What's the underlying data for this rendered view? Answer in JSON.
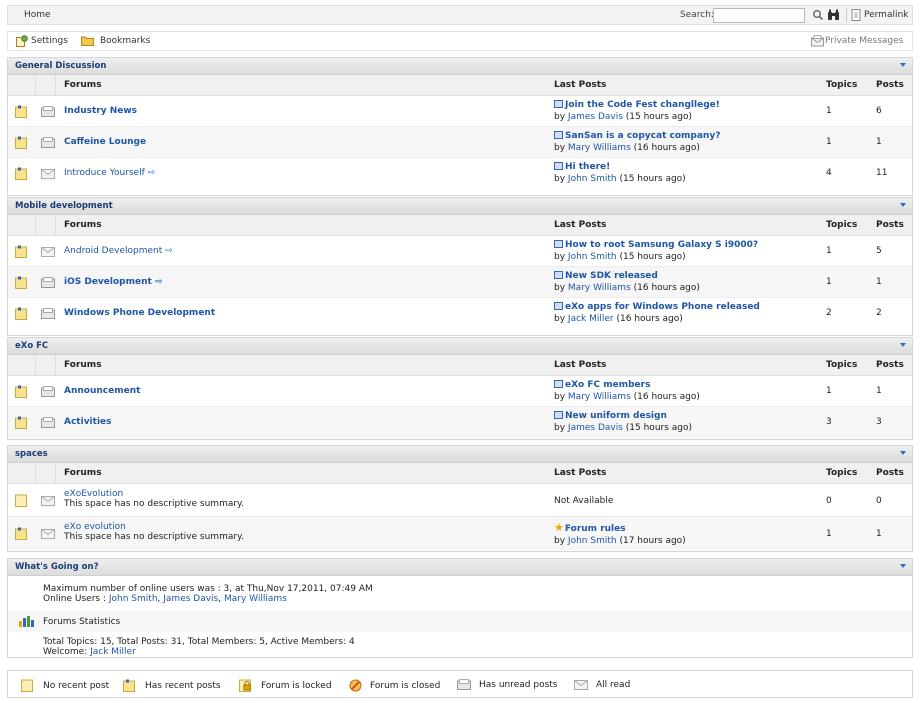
{
  "topbar": {
    "home": "Home",
    "search_label": "Search:",
    "search_value": "",
    "permalink": "Permalink"
  },
  "actions": {
    "settings": "Settings",
    "bookmarks": "Bookmarks",
    "private_messages": "Private Messages"
  },
  "columns": {
    "forums": "Forums",
    "last_posts": "Last Posts",
    "topics": "Topics",
    "posts": "Posts"
  },
  "categories": [
    {
      "title": "General Discussion",
      "forums": [
        {
          "name": "Industry News",
          "bold": true,
          "post_title": "Join the Code Fest changllege!",
          "by": "by",
          "author": "James Davis",
          "ago": "(15 hours ago)",
          "topics": "1",
          "posts": "6"
        },
        {
          "name": "Caffeine Lounge",
          "bold": true,
          "post_title": "SanSan is a copycat company?",
          "by": "by",
          "author": "Mary Williams",
          "ago": "(16 hours ago)",
          "topics": "1",
          "posts": "1"
        },
        {
          "name": "Introduce Yourself",
          "bold": false,
          "post_title": "Hi there!",
          "by": "by",
          "author": "John Smith",
          "ago": "(15 hours ago)",
          "topics": "4",
          "posts": "11"
        }
      ]
    },
    {
      "title": "Mobile development",
      "forums": [
        {
          "name": "Android Development",
          "bold": false,
          "post_title": "How to root Samsung Galaxy S i9000?",
          "by": "by",
          "author": "John Smith",
          "ago": "(15 hours ago)",
          "topics": "1",
          "posts": "5"
        },
        {
          "name": "iOS Development",
          "bold": true,
          "post_title": "New SDK released",
          "by": "by",
          "author": "Mary Williams",
          "ago": "(16 hours ago)",
          "topics": "1",
          "posts": "1"
        },
        {
          "name": "Windows Phone Development",
          "bold": true,
          "post_title": "eXo apps for Windows Phone released",
          "by": "by",
          "author": "Jack Miller",
          "ago": "(16 hours ago)",
          "topics": "2",
          "posts": "2"
        }
      ]
    },
    {
      "title": "eXo FC",
      "forums": [
        {
          "name": "Announcement",
          "bold": true,
          "post_title": "eXo FC members",
          "by": "by",
          "author": "Mary Williams",
          "ago": "(16 hours ago)",
          "topics": "1",
          "posts": "1"
        },
        {
          "name": "Activities",
          "bold": true,
          "post_title": "New uniform design",
          "by": "by",
          "author": "James Davis",
          "ago": "(15 hours ago)",
          "topics": "3",
          "posts": "3"
        }
      ]
    },
    {
      "title": "spaces",
      "forums": [
        {
          "name": "eXoEvolution",
          "desc": "This space has no descriptive summary.",
          "last_post_text": "Not Available",
          "topics": "0",
          "posts": "0"
        },
        {
          "name": "eXo evolution",
          "desc": "This space has no descriptive summary.",
          "post_title": "Forum rules",
          "by": "by",
          "author": "John Smith",
          "ago": "(17 hours ago)",
          "topics": "1",
          "posts": "1"
        }
      ]
    }
  ],
  "whats_going_on": {
    "title": "What's Going on?",
    "max_users": "Maximum number of online users was : 3, at Thu,Nov 17,2011, 07:49 AM",
    "online_label": "Online Users :",
    "online_users": [
      "John Smith",
      "James Davis",
      "Mary Williams"
    ],
    "stats_title": "Forums Statistics",
    "totals": "Total Topics: 15, Total Posts: 31, Total Members: 5, Active Members: 4",
    "welcome_label": "Welcome:",
    "welcome_user": "Jack Miller"
  },
  "legend": {
    "no_recent": "No recent post",
    "has_recent": "Has recent posts",
    "locked": "Forum is locked",
    "closed": "Forum is closed",
    "unread": "Has unread posts",
    "all_read": "All read"
  }
}
